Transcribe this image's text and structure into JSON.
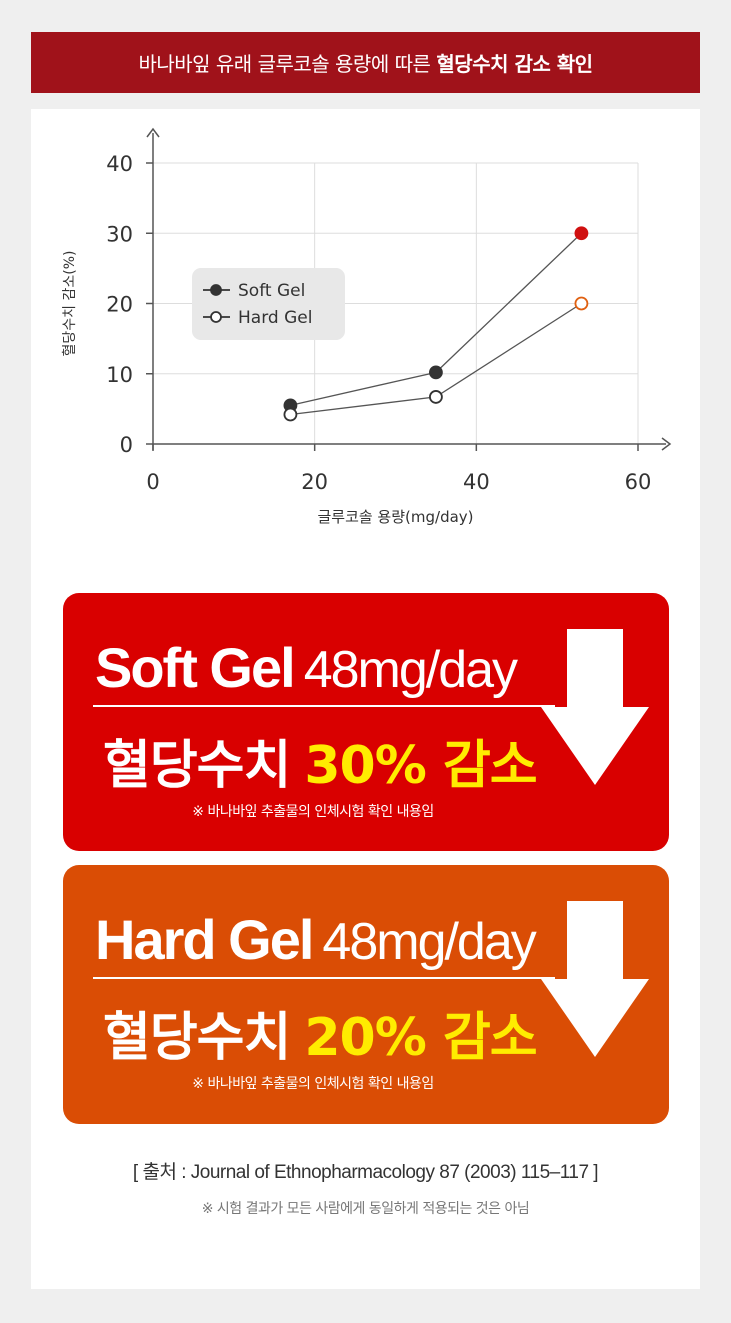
{
  "header": {
    "title_prefix": "바나바잎 유래 글루코솔 용량에 따른",
    "title_highlight": "혈당수치 감소 확인"
  },
  "chart_data": {
    "type": "line",
    "title": "",
    "xlabel": "글루코솔 용량(mg/day)",
    "ylabel": "혈당수치 감소(%)",
    "xlim": [
      0,
      60
    ],
    "ylim": [
      0,
      40
    ],
    "x_ticks": [
      "0",
      "20",
      "40",
      "60"
    ],
    "y_ticks": [
      "0",
      "10",
      "20",
      "30",
      "40"
    ],
    "grid": true,
    "legend": "upper-left",
    "x": [
      17,
      35,
      53
    ],
    "series": [
      {
        "name": "Soft Gel",
        "values": [
          5.5,
          10.2,
          30
        ],
        "marker": "filled"
      },
      {
        "name": "Hard Gel",
        "values": [
          4.2,
          6.7,
          20
        ],
        "marker": "open"
      }
    ],
    "colors": {
      "line": "#555555",
      "highlight": "#d01010",
      "highlight_open": "#e06010"
    }
  },
  "cards": [
    {
      "brand": "Soft Gel",
      "dose": "48mg/day",
      "effect": "혈당수치",
      "percent": "30% 감소",
      "note": "※ 바나바잎 추출물의 인체시험 확인 내용임",
      "color": "#d90000"
    },
    {
      "brand": "Hard Gel",
      "dose": "48mg/day",
      "effect": "혈당수치",
      "percent": "20% 감소",
      "note": "※ 바나바잎 추출물의 인체시험 확인 내용임",
      "color": "#da4d05"
    }
  ],
  "source": "[ 출처 : Journal of Ethnopharmacology 87 (2003) 115–117 ]",
  "disclaimer": "※ 시험 결과가 모든 사람에게 동일하게 적용되는 것은 아님"
}
